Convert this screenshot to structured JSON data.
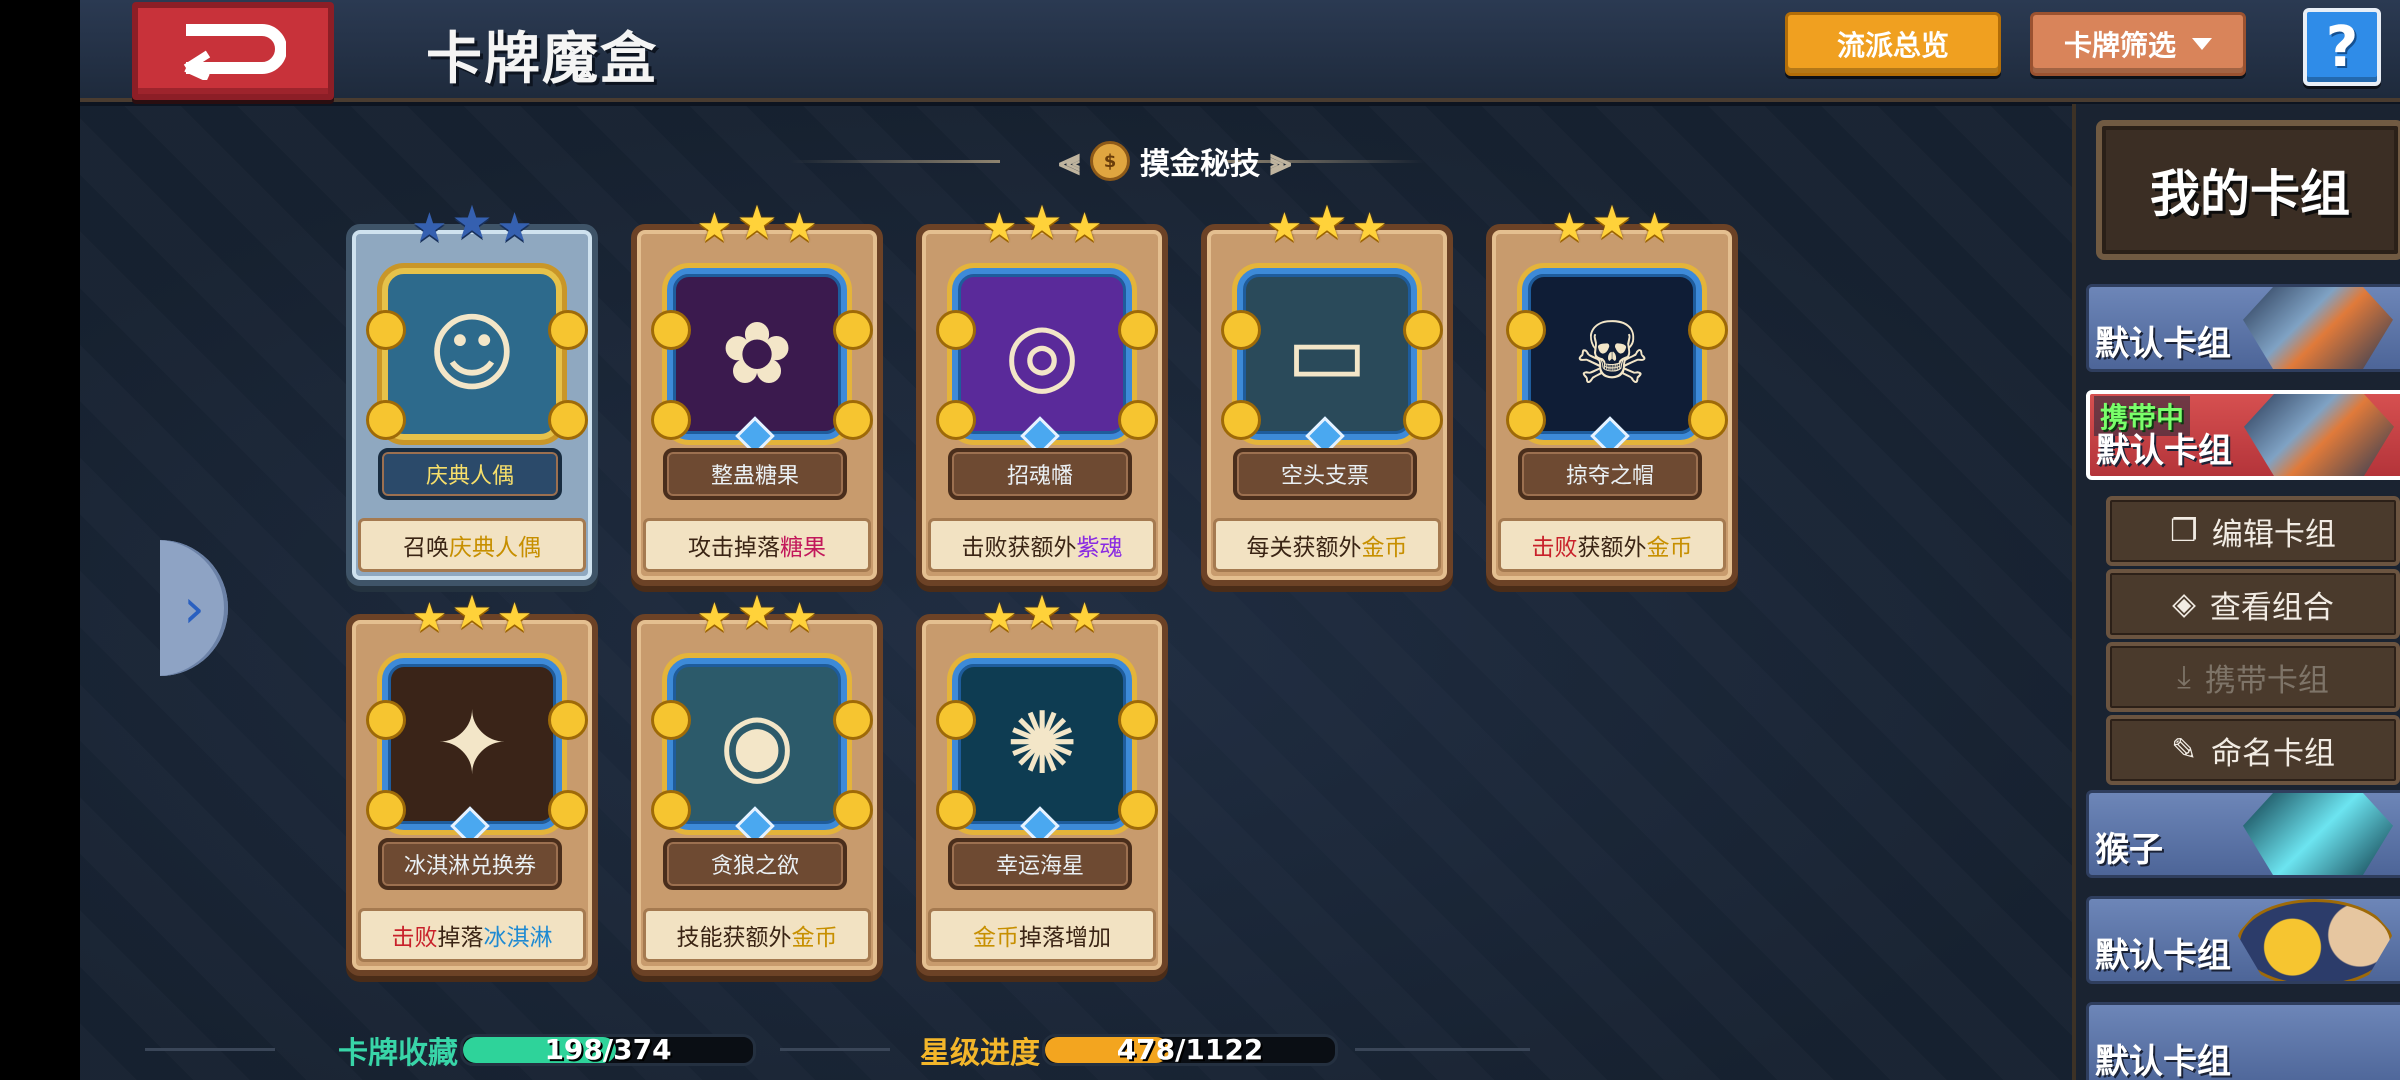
{
  "header": {
    "title": "卡牌魔盒",
    "overview_label": "流派总览",
    "filter_label": "卡牌筛选",
    "help_label": "?"
  },
  "section": {
    "title": "摸金秘技"
  },
  "cards": [
    {
      "name": "庆典人偶",
      "desc_parts": [
        "召唤",
        "庆典人偶"
      ],
      "stars": 3,
      "rarity": "legend",
      "icon": "doll-icon"
    },
    {
      "name": "整蛊糖果",
      "desc_parts": [
        "攻击掉落",
        "糖果"
      ],
      "stars": 3,
      "rarity": "normal",
      "icon": "candy-icon"
    },
    {
      "name": "招魂幡",
      "desc_parts": [
        "击败获额外",
        "紫魂"
      ],
      "stars": 3,
      "rarity": "normal",
      "icon": "soul-banner-icon"
    },
    {
      "name": "空头支票",
      "desc_parts": [
        "每关获额外",
        "金币"
      ],
      "stars": 3,
      "rarity": "normal",
      "icon": "check-icon"
    },
    {
      "name": "掠夺之帽",
      "desc_parts": [
        "击败",
        "获额外",
        "金币"
      ],
      "stars": 3,
      "rarity": "normal",
      "icon": "pirate-hat-icon"
    },
    {
      "name": "冰淇淋兑换券",
      "desc_parts": [
        "击败",
        "掉落",
        "冰淇淋"
      ],
      "stars": 3,
      "rarity": "normal",
      "icon": "ice-cream-ticket-icon"
    },
    {
      "name": "贪狼之欲",
      "desc_parts": [
        "技能获额外",
        "金币"
      ],
      "stars": 3,
      "rarity": "normal",
      "icon": "wolf-icon"
    },
    {
      "name": "幸运海星",
      "desc_parts": [
        "金币",
        "掉落增加"
      ],
      "stars": 3,
      "rarity": "normal",
      "icon": "lucky-star-icon"
    }
  ],
  "sidebar": {
    "title": "我的卡组",
    "decks": [
      {
        "name": "默认卡组",
        "tag": ""
      },
      {
        "name": "默认卡组",
        "tag": "携带中"
      },
      {
        "name": "猴子",
        "tag": ""
      },
      {
        "name": "默认卡组",
        "tag": ""
      },
      {
        "name": "默认卡组",
        "tag": ""
      }
    ],
    "actions": {
      "edit": "编辑卡组",
      "view": "查看组合",
      "carry": "携带卡组",
      "rename": "命名卡组"
    }
  },
  "progress": {
    "collection_label": "卡牌收藏",
    "collection_text": "198/374",
    "collection_fraction": 0.529,
    "star_label": "星级进度",
    "star_text": "478/1122",
    "star_fraction": 0.426
  },
  "colors": {
    "overview_button": "#f0a020",
    "filter_button": "#d9845a",
    "active_deck": "#c8323a",
    "collection_bar": "#2ed39a",
    "star_bar": "#f3a51f"
  }
}
